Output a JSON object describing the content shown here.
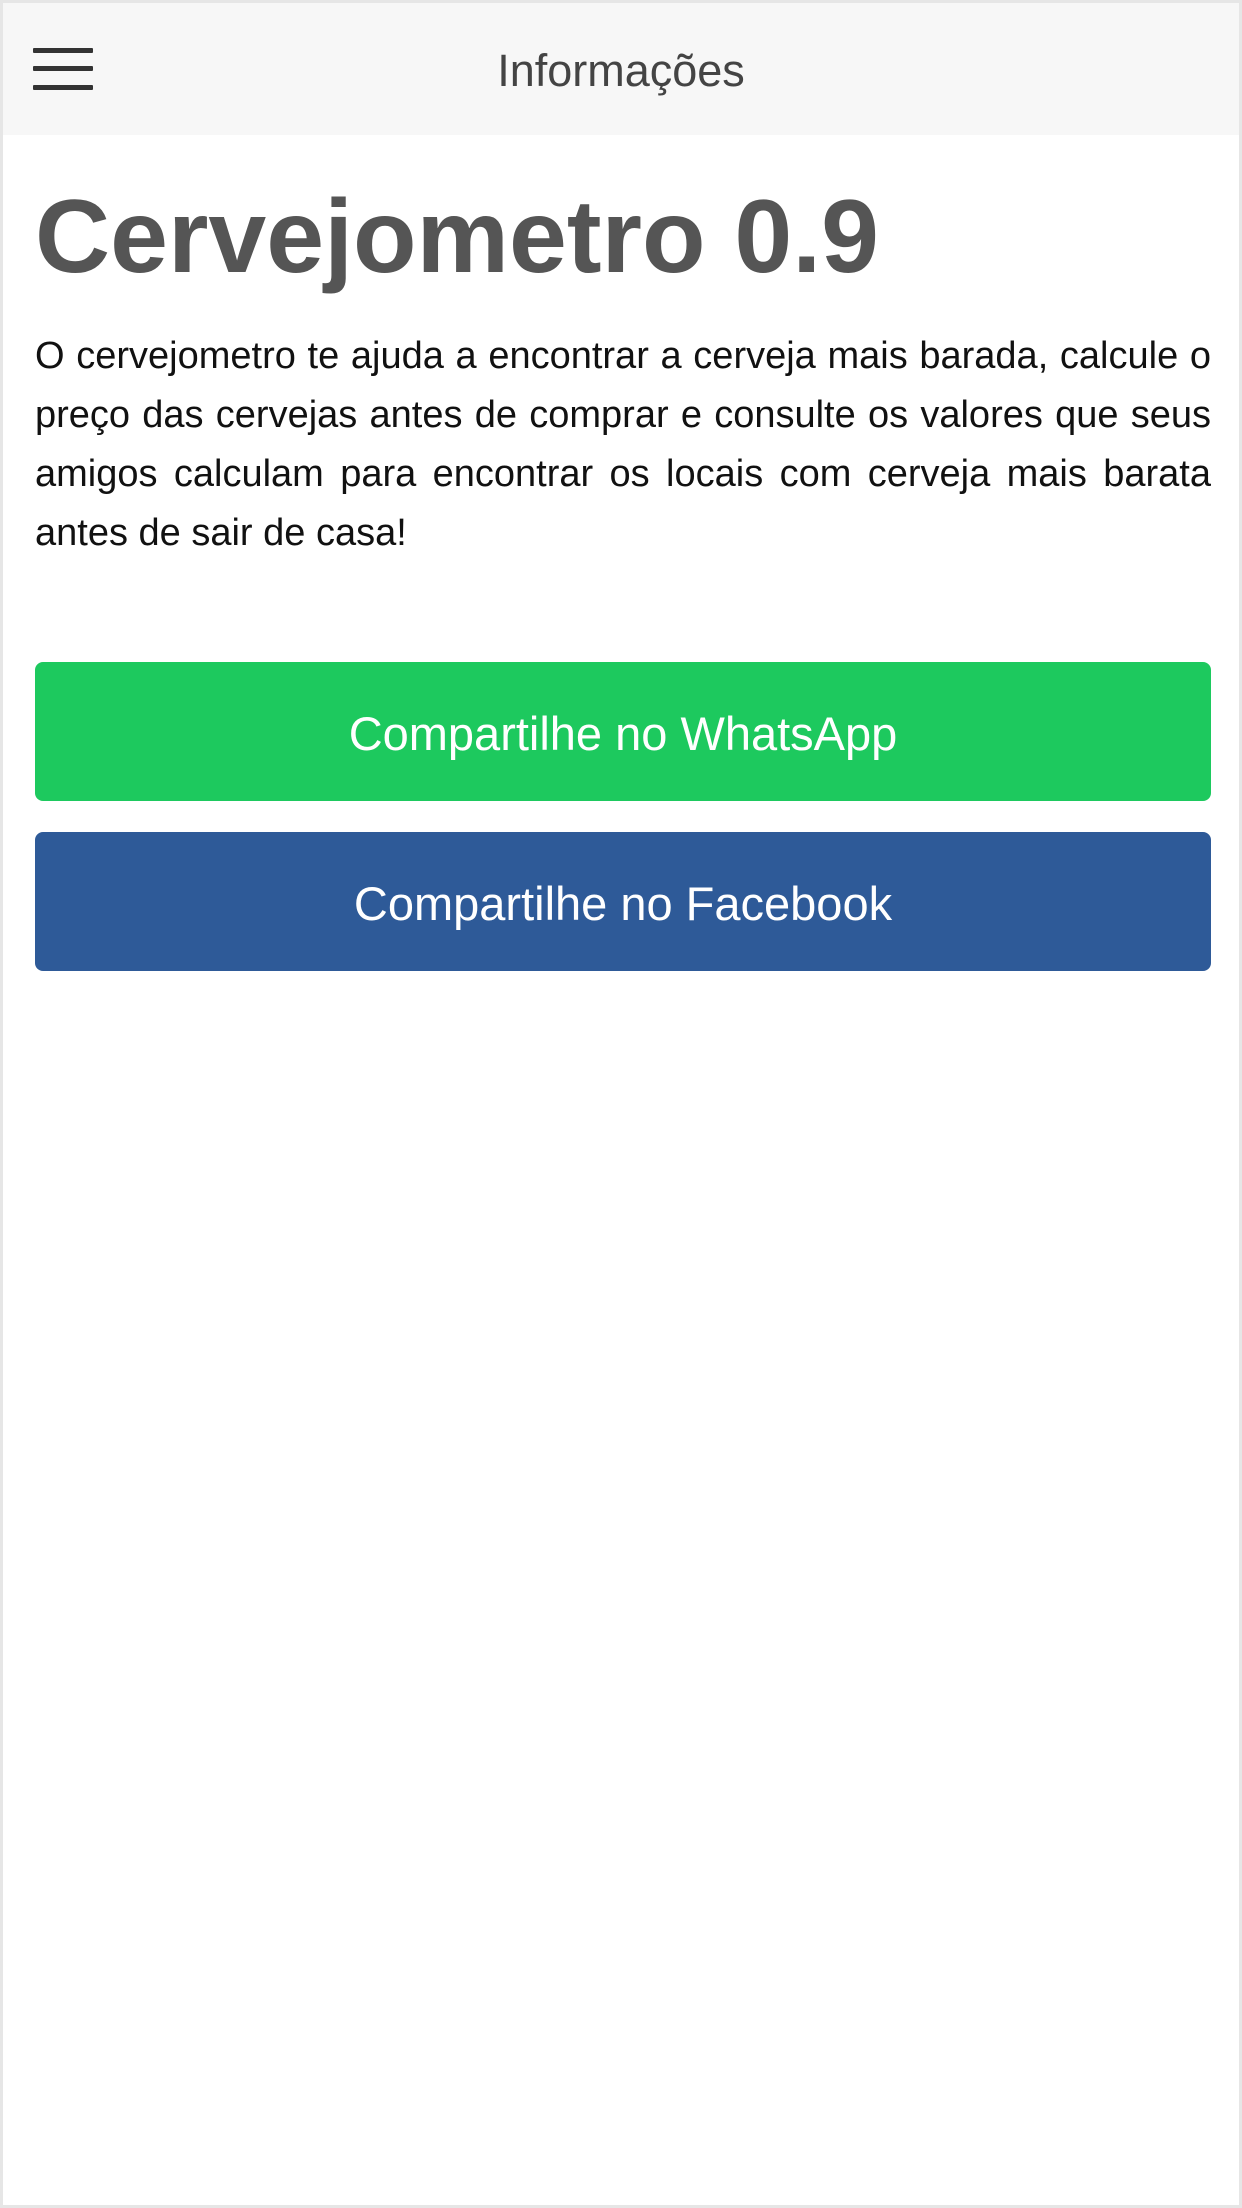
{
  "header": {
    "title": "Informações",
    "menu_icon": "hamburger-menu-icon"
  },
  "main": {
    "app_title": "Cervejometro 0.9",
    "description": "O cervejometro te ajuda a encontrar a cerveja mais barada, calcule o preço das cervejas antes de comprar e consulte os valores que seus amigos calculam para encontrar os locais com cerveja mais barata antes de sair de casa!",
    "whatsapp_button": "Compartilhe no WhatsApp",
    "facebook_button": "Compartilhe no Facebook"
  },
  "colors": {
    "navbar_bg": "#f7f7f7",
    "whatsapp": "#1dc95e",
    "facebook": "#2e5a98",
    "title_text": "#555555"
  }
}
